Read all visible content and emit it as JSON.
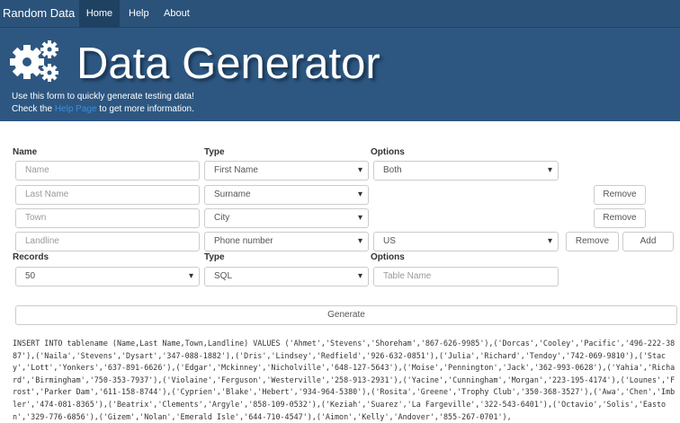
{
  "nav": {
    "brand": "Random Data",
    "items": [
      "Home",
      "Help",
      "About"
    ],
    "active": "Home"
  },
  "hero": {
    "title": "Data Generator",
    "line1": "Use this form to quickly generate testing data!",
    "line2_pre": "Check the ",
    "line2_link": "Help Page",
    "line2_post": " to get more information."
  },
  "labels": {
    "name": "Name",
    "type": "Type",
    "options": "Options",
    "records": "Records",
    "type2": "Type",
    "options2": "Options"
  },
  "fields": [
    {
      "name": "Name",
      "type": "First Name",
      "option": "Both"
    },
    {
      "name": "Last Name",
      "type": "Surname"
    },
    {
      "name": "Town",
      "type": "City"
    },
    {
      "name": "Landline",
      "type": "Phone number",
      "option": "US"
    }
  ],
  "records": "50",
  "output_type": "SQL",
  "table_name_placeholder": "Table Name",
  "buttons": {
    "remove": "Remove",
    "add": "Add",
    "generate": "Generate"
  },
  "output": "INSERT INTO tablename (Name,Last Name,Town,Landline) VALUES ('Ahmet','Stevens','Shoreham','867-626-9985'),('Dorcas','Cooley','Pacific','496-222-3887'),('Naila','Stevens','Dysart','347-088-1882'),('Dris','Lindsey','Redfield','926-632-0851'),('Julia','Richard','Tendoy','742-069-9810'),('Stacy','Lott','Yonkers','637-891-6626'),('Edgar','Mckinney','Nicholville','648-127-5643'),('Moise','Pennington','Jack','362-993-0628'),('Yahia','Richard','Birmingham','750-353-7937'),('Violaine','Ferguson','Westerville','258-913-2931'),('Yacine','Cunningham','Morgan','223-195-4174'),('Lounes','Frost','Parker Dam','611-158-8744'),('Cyprien','Blake','Hebert','934-964-5380'),('Rosita','Greene','Trophy Club','350-368-3527'),('Awa','Chen','Imbler','474-081-8365'),('Beatrix','Clements','Argyle','858-109-0532'),('Keziah','Suarez','La Fargeville','322-543-6401'),('Octavio','Solis','Easton','329-776-6856'),('Gizem','Nolan','Emerald Isle','644-710-4547'),('Aimon','Kelly','Andover','855-267-0701'),"
}
